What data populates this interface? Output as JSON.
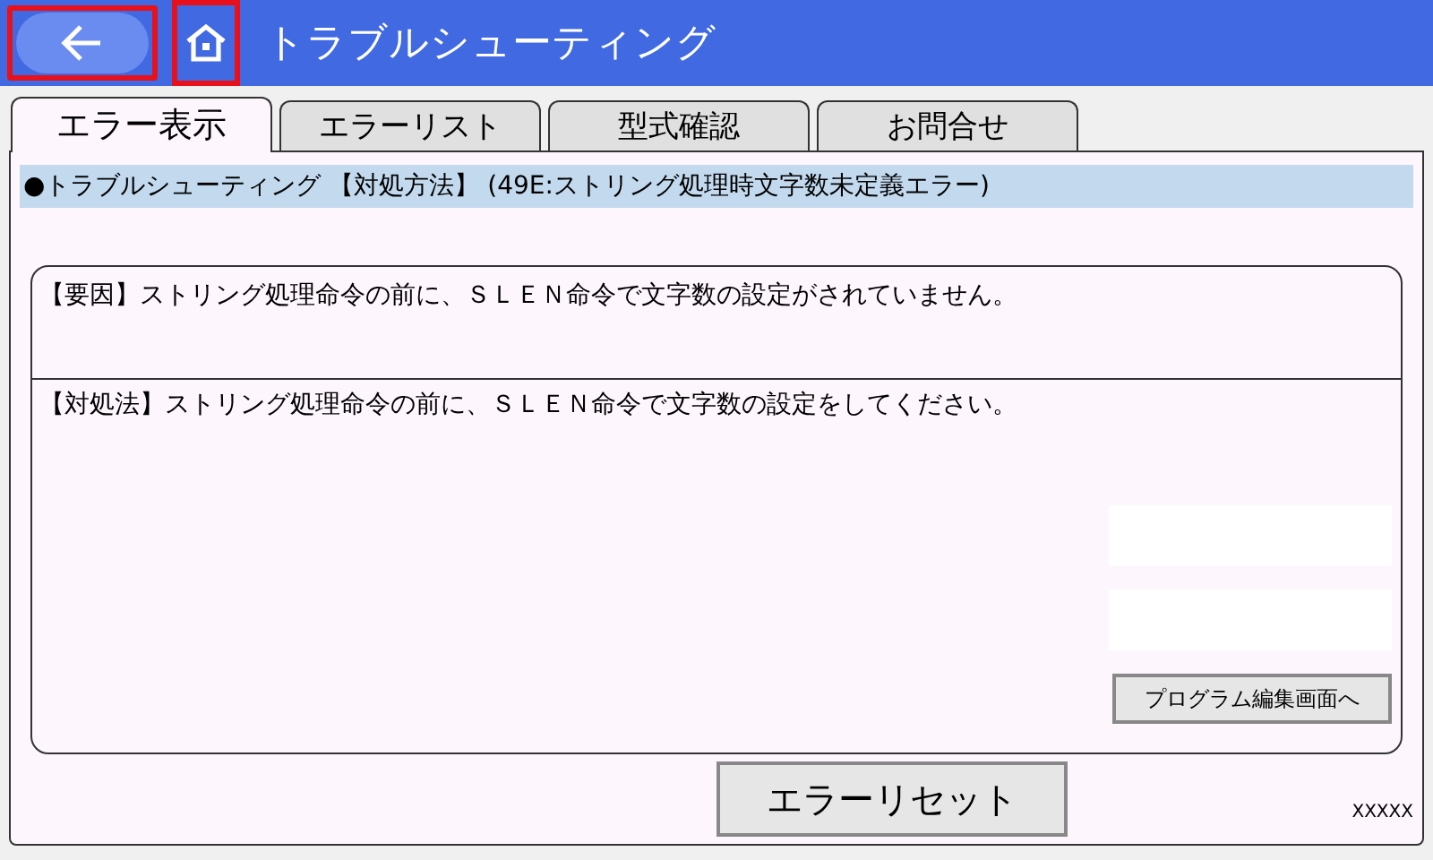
{
  "header": {
    "title": "トラブルシューティング",
    "back_button": {
      "highlighted": true
    },
    "home_button": {
      "highlighted": true
    }
  },
  "tabs": [
    {
      "label": "エラー表示",
      "selected": true
    },
    {
      "label": "エラーリスト",
      "selected": false
    },
    {
      "label": "型式確認",
      "selected": false
    },
    {
      "label": "お問合せ",
      "selected": false
    }
  ],
  "info_bar": "●トラブルシューティング 【対処方法】 (49E:ストリング処理時文字数未定義エラー)",
  "cause": "【要因】ストリング処理命令の前に、ＳＬＥＮ命令で文字数の設定がされていません。",
  "remedy": "【対処法】ストリング処理命令の前に、ＳＬＥＮ命令で文字数の設定をしてください。",
  "program_edit_button": "プログラム編集画面へ",
  "reset_button": "エラーリセット",
  "footer_code": "XXXXX"
}
